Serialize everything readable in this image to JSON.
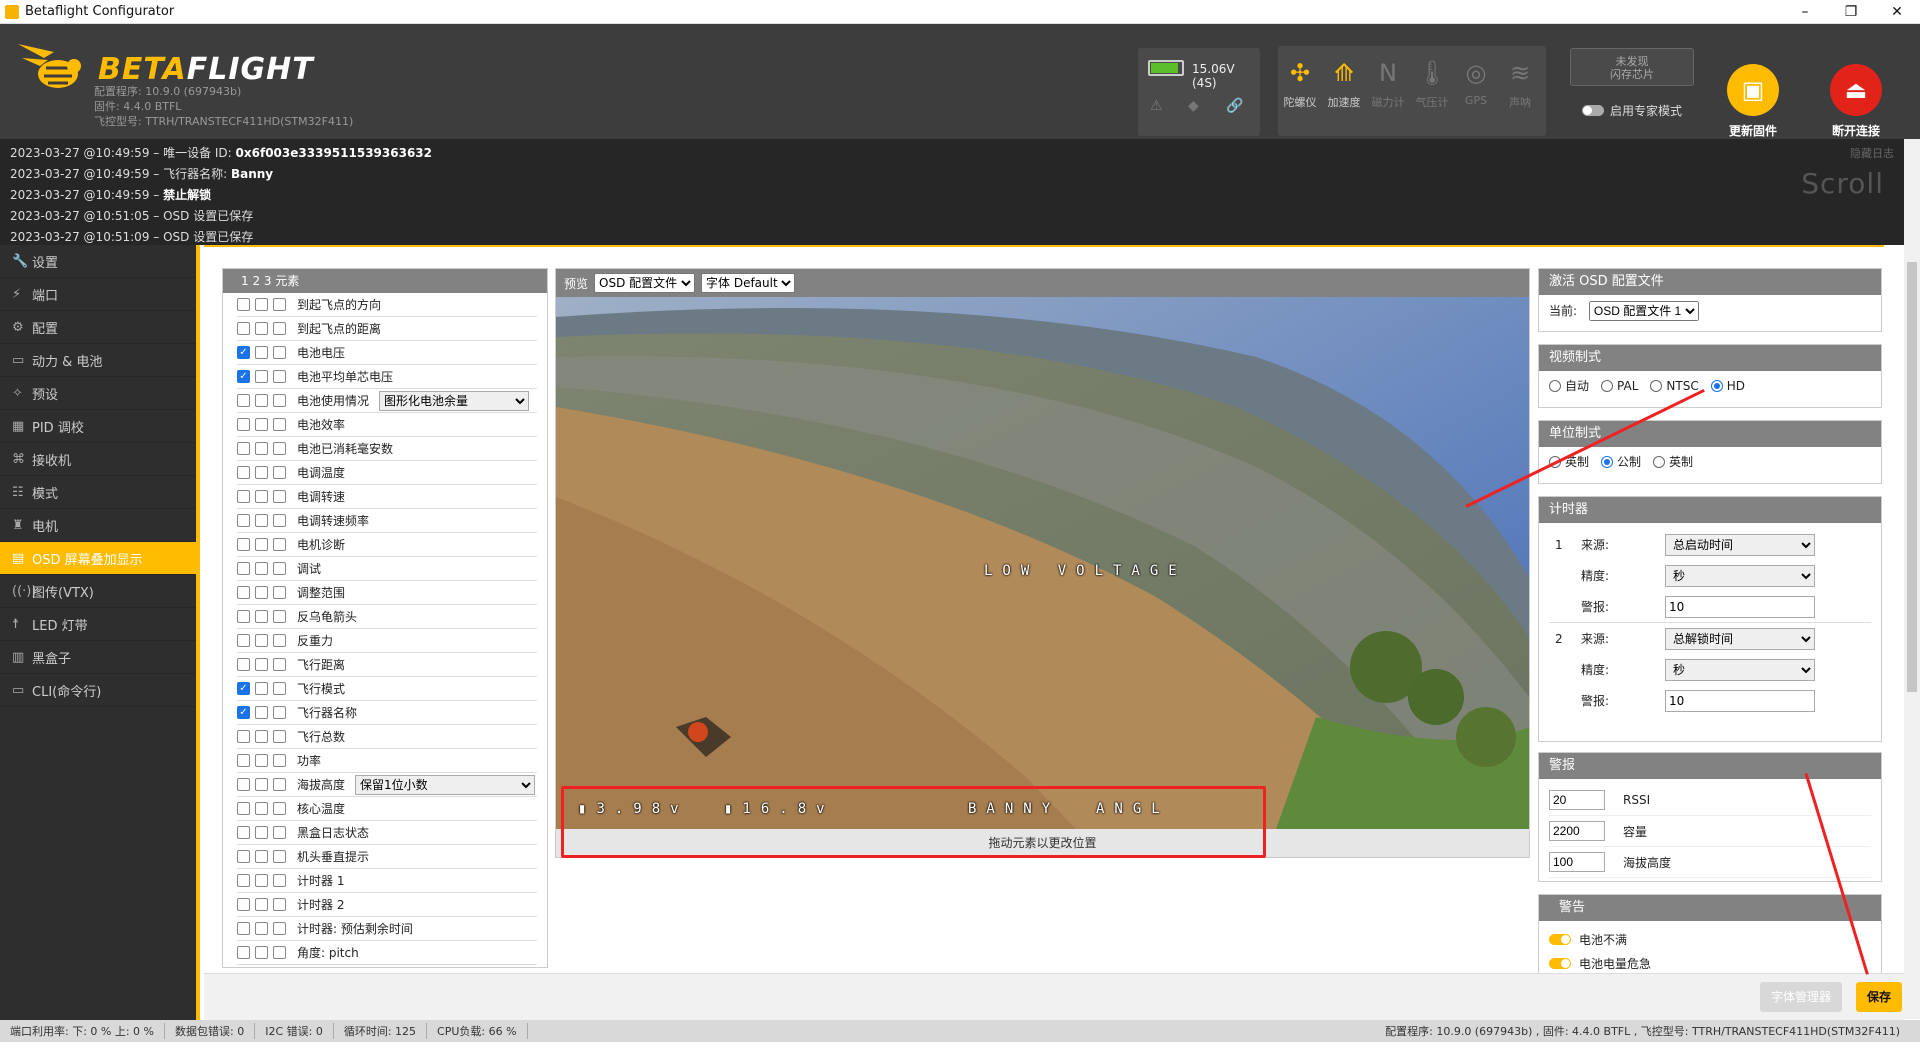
{
  "window": {
    "title": "Betaflight Configurator",
    "minimize": "–",
    "maximize": "❐",
    "close": "✕"
  },
  "header": {
    "logo_beta": "BETA",
    "logo_flight": "FLIGHT",
    "meta": [
      "配置程序: 10.9.0 (697943b)",
      "固件: 4.4.0 BTFL",
      "飞控型号: TTRH/TRANSTECF411HD(STM32F411)"
    ],
    "battery": {
      "voltage": "15.06V (4S)",
      "level": 0.9
    },
    "sensors": [
      {
        "label": "陀螺仪",
        "icon": "gyro-icon",
        "glyph": "✣",
        "on": true
      },
      {
        "label": "加速度",
        "icon": "accelerometer-icon",
        "glyph": "⟰",
        "on": true
      },
      {
        "label": "磁力计",
        "icon": "magnetometer-icon",
        "glyph": "N",
        "on": false
      },
      {
        "label": "气压计",
        "icon": "barometer-icon",
        "glyph": "🌡",
        "on": false
      },
      {
        "label": "GPS",
        "icon": "gps-icon",
        "glyph": "◎",
        "on": false
      },
      {
        "label": "声呐",
        "icon": "sonar-icon",
        "glyph": "≋",
        "on": false
      }
    ],
    "dataflash": "未发现\n闪存芯片",
    "expert_mode": "启用专家模式",
    "update_firmware": "更新固件",
    "disconnect": "断开连接"
  },
  "log": {
    "lines": [
      {
        "time": "2023-03-27 @10:49:59",
        "text": " – 唯一设备 ID: ",
        "bold": "0x6f003e3339511539363632"
      },
      {
        "time": "2023-03-27 @10:49:59",
        "text": " – 飞行器名称: ",
        "bold": "Banny"
      },
      {
        "time": "2023-03-27 @10:49:59",
        "text": " – ",
        "bold": "禁止解锁"
      },
      {
        "time": "2023-03-27 @10:51:05",
        "text": " – OSD 设置已保存",
        "bold": ""
      },
      {
        "time": "2023-03-27 @10:51:09",
        "text": " – OSD 设置已保存",
        "bold": ""
      }
    ],
    "hide": "隐藏日志",
    "scroll": "Scroll"
  },
  "nav": [
    {
      "label": "设置",
      "icon": "wrench-icon",
      "glyph": "🔧"
    },
    {
      "label": "端口",
      "icon": "port-icon",
      "glyph": "⚡"
    },
    {
      "label": "配置",
      "icon": "gear-icon",
      "glyph": "⚙"
    },
    {
      "label": "动力 & 电池",
      "icon": "battery-icon",
      "glyph": "▭"
    },
    {
      "label": "预设",
      "icon": "preset-icon",
      "glyph": "✧"
    },
    {
      "label": "PID 调校",
      "icon": "pid-icon",
      "glyph": "▦"
    },
    {
      "label": "接收机",
      "icon": "receiver-icon",
      "glyph": "⌘"
    },
    {
      "label": "模式",
      "icon": "modes-icon",
      "glyph": "☷"
    },
    {
      "label": "电机",
      "icon": "motor-icon",
      "glyph": "♜"
    },
    {
      "label": "OSD 屏幕叠加显示",
      "icon": "osd-icon",
      "glyph": "▤",
      "active": true
    },
    {
      "label": "图传(VTX)",
      "icon": "vtx-icon",
      "glyph": "((·))"
    },
    {
      "label": "LED 灯带",
      "icon": "led-icon",
      "glyph": "☨"
    },
    {
      "label": "黑盒子",
      "icon": "blackbox-icon",
      "glyph": "▥"
    },
    {
      "label": "CLI(命令行)",
      "icon": "cli-icon",
      "glyph": "▭"
    }
  ],
  "elements": {
    "header": "1  2  3  元素",
    "items": [
      {
        "label": "到起飞点的方向",
        "c": [
          0,
          0,
          0
        ]
      },
      {
        "label": "到起飞点的距离",
        "c": [
          0,
          0,
          0
        ]
      },
      {
        "label": "电池电压",
        "c": [
          1,
          0,
          0
        ]
      },
      {
        "label": "电池平均单芯电压",
        "c": [
          1,
          0,
          0
        ]
      },
      {
        "label": "电池使用情况",
        "c": [
          0,
          0,
          0
        ],
        "select": "图形化电池余量"
      },
      {
        "label": "电池效率",
        "c": [
          0,
          0,
          0
        ]
      },
      {
        "label": "电池已消耗毫安数",
        "c": [
          0,
          0,
          0
        ]
      },
      {
        "label": "电调温度",
        "c": [
          0,
          0,
          0
        ]
      },
      {
        "label": "电调转速",
        "c": [
          0,
          0,
          0
        ]
      },
      {
        "label": "电调转速频率",
        "c": [
          0,
          0,
          0
        ]
      },
      {
        "label": "电机诊断",
        "c": [
          0,
          0,
          0
        ]
      },
      {
        "label": "调试",
        "c": [
          0,
          0,
          0
        ]
      },
      {
        "label": "调整范围",
        "c": [
          0,
          0,
          0
        ]
      },
      {
        "label": "反乌龟箭头",
        "c": [
          0,
          0,
          0
        ]
      },
      {
        "label": "反重力",
        "c": [
          0,
          0,
          0
        ]
      },
      {
        "label": "飞行距离",
        "c": [
          0,
          0,
          0
        ]
      },
      {
        "label": "飞行模式",
        "c": [
          1,
          0,
          0
        ]
      },
      {
        "label": "飞行器名称",
        "c": [
          1,
          0,
          0
        ]
      },
      {
        "label": "飞行总数",
        "c": [
          0,
          0,
          0
        ]
      },
      {
        "label": "功率",
        "c": [
          0,
          0,
          0
        ]
      },
      {
        "label": "海拔高度",
        "c": [
          0,
          0,
          0
        ],
        "select": "保留1位小数"
      },
      {
        "label": "核心温度",
        "c": [
          0,
          0,
          0
        ]
      },
      {
        "label": "黑盒日志状态",
        "c": [
          0,
          0,
          0
        ]
      },
      {
        "label": "机头垂直提示",
        "c": [
          0,
          0,
          0
        ]
      },
      {
        "label": "计时器 1",
        "c": [
          0,
          0,
          0
        ]
      },
      {
        "label": "计时器 2",
        "c": [
          0,
          0,
          0
        ]
      },
      {
        "label": "计时器: 预估剩余时间",
        "c": [
          0,
          0,
          0
        ]
      },
      {
        "label": "角度: pitch",
        "c": [
          0,
          0,
          0
        ]
      }
    ]
  },
  "preview": {
    "label": "预览",
    "profile": "OSD 配置文件",
    "font": "字体 Default",
    "osd_warning": "LOW VOLTAGE",
    "osd_voltage": "3.98v",
    "osd_avg": "16.8v",
    "osd_name": "BANNY",
    "osd_mode": "ANGL",
    "footer": "拖动元素以更改位置"
  },
  "active_profile": {
    "title": "激活 OSD 配置文件",
    "current_label": "当前:",
    "current": "OSD 配置文件 1"
  },
  "video_format": {
    "title": "视频制式",
    "options": [
      "自动",
      "PAL",
      "NTSC",
      "HD"
    ],
    "selected": "HD"
  },
  "units": {
    "title": "单位制式",
    "options": [
      "英制",
      "公制",
      "英制"
    ],
    "selected_index": 1
  },
  "timers": {
    "title": "计时器",
    "items": [
      {
        "num": "1",
        "source_label": "来源:",
        "source": "总启动时间",
        "precision_label": "精度:",
        "precision": "秒",
        "alarm_label": "警报:",
        "alarm": "10"
      },
      {
        "num": "2",
        "source_label": "来源:",
        "source": "总解锁时间",
        "precision_label": "精度:",
        "precision": "秒",
        "alarm_label": "警报:",
        "alarm": "10"
      }
    ]
  },
  "alarms": {
    "title": "警报",
    "items": [
      {
        "value": "20",
        "label": "RSSI"
      },
      {
        "value": "2200",
        "label": "容量"
      },
      {
        "value": "100",
        "label": "海拔高度"
      }
    ]
  },
  "warnings": {
    "title": "警告",
    "items": [
      "电池不满",
      "电池电量危急"
    ]
  },
  "buttons": {
    "font_manager": "字体管理器",
    "save": "保存"
  },
  "status": {
    "port": "端口利用率:   下: 0 %  上: 0 %",
    "packet_err": "数据包错误: 0",
    "i2c": "I2C 错误: 0",
    "cycle": "循环时间: 125",
    "cpu": "CPU负载: 66 %",
    "right": "配置程序: 10.9.0 (697943b) , 固件: 4.4.0 BTFL , 飞控型号: TTRH/TRANSTECF411HD(STM32F411)"
  },
  "colors": {
    "accent": "#ffbb00",
    "annotation": "#ee2222",
    "header_bg": "#3d3d3d"
  }
}
